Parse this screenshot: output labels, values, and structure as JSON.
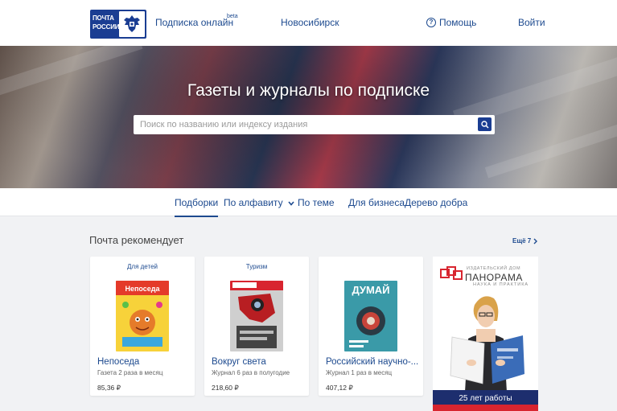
{
  "header": {
    "logo_line1": "ПОЧТА",
    "logo_line2": "РОССИИ",
    "subscribe_label": "Подписка онлайн",
    "beta_label": "beta",
    "city_label": "Новосибирск",
    "help_label": "Помощь",
    "login_label": "Войти"
  },
  "hero": {
    "title": "Газеты и журналы по подписке",
    "search_placeholder": "Поиск по названию или индексу издания",
    "search_value": ""
  },
  "tabs": [
    {
      "label": "Подборки",
      "active": true
    },
    {
      "label": "По алфавиту",
      "active": false
    },
    {
      "label": "По теме",
      "active": false
    },
    {
      "label": "Для бизнеса",
      "active": false
    },
    {
      "label": "Дерево добра",
      "active": false
    }
  ],
  "recommend": {
    "title": "Почта рекомендует",
    "see_all": "Ещё 7",
    "cards": [
      {
        "category": "Для детей",
        "title": "Непоседа",
        "desc": "Газета 2 раза в месяц",
        "price": "85,36 ₽",
        "cover_title": "Непоседа"
      },
      {
        "category": "Туризм",
        "title": "Вокруг света",
        "desc": "Журнал 6 раз в полугодие",
        "price": "218,60 ₽"
      },
      {
        "category": "",
        "title": "Российский научно-...",
        "desc": "Журнал 1 раз в месяц",
        "price": "407,12 ₽",
        "cover_title": "ДУМАЙ"
      }
    ]
  },
  "ad": {
    "publisher": "ИЗДАТЕЛЬСКИЙ ДОМ",
    "brand": "ПАНОРАМА",
    "tagline": "НАУКА И ПРАКТИКА",
    "banner": "25 лет работы"
  },
  "colors": {
    "brand_blue": "#1a3d92",
    "link_blue": "#1d4a8f",
    "ad_red": "#d8252f"
  }
}
